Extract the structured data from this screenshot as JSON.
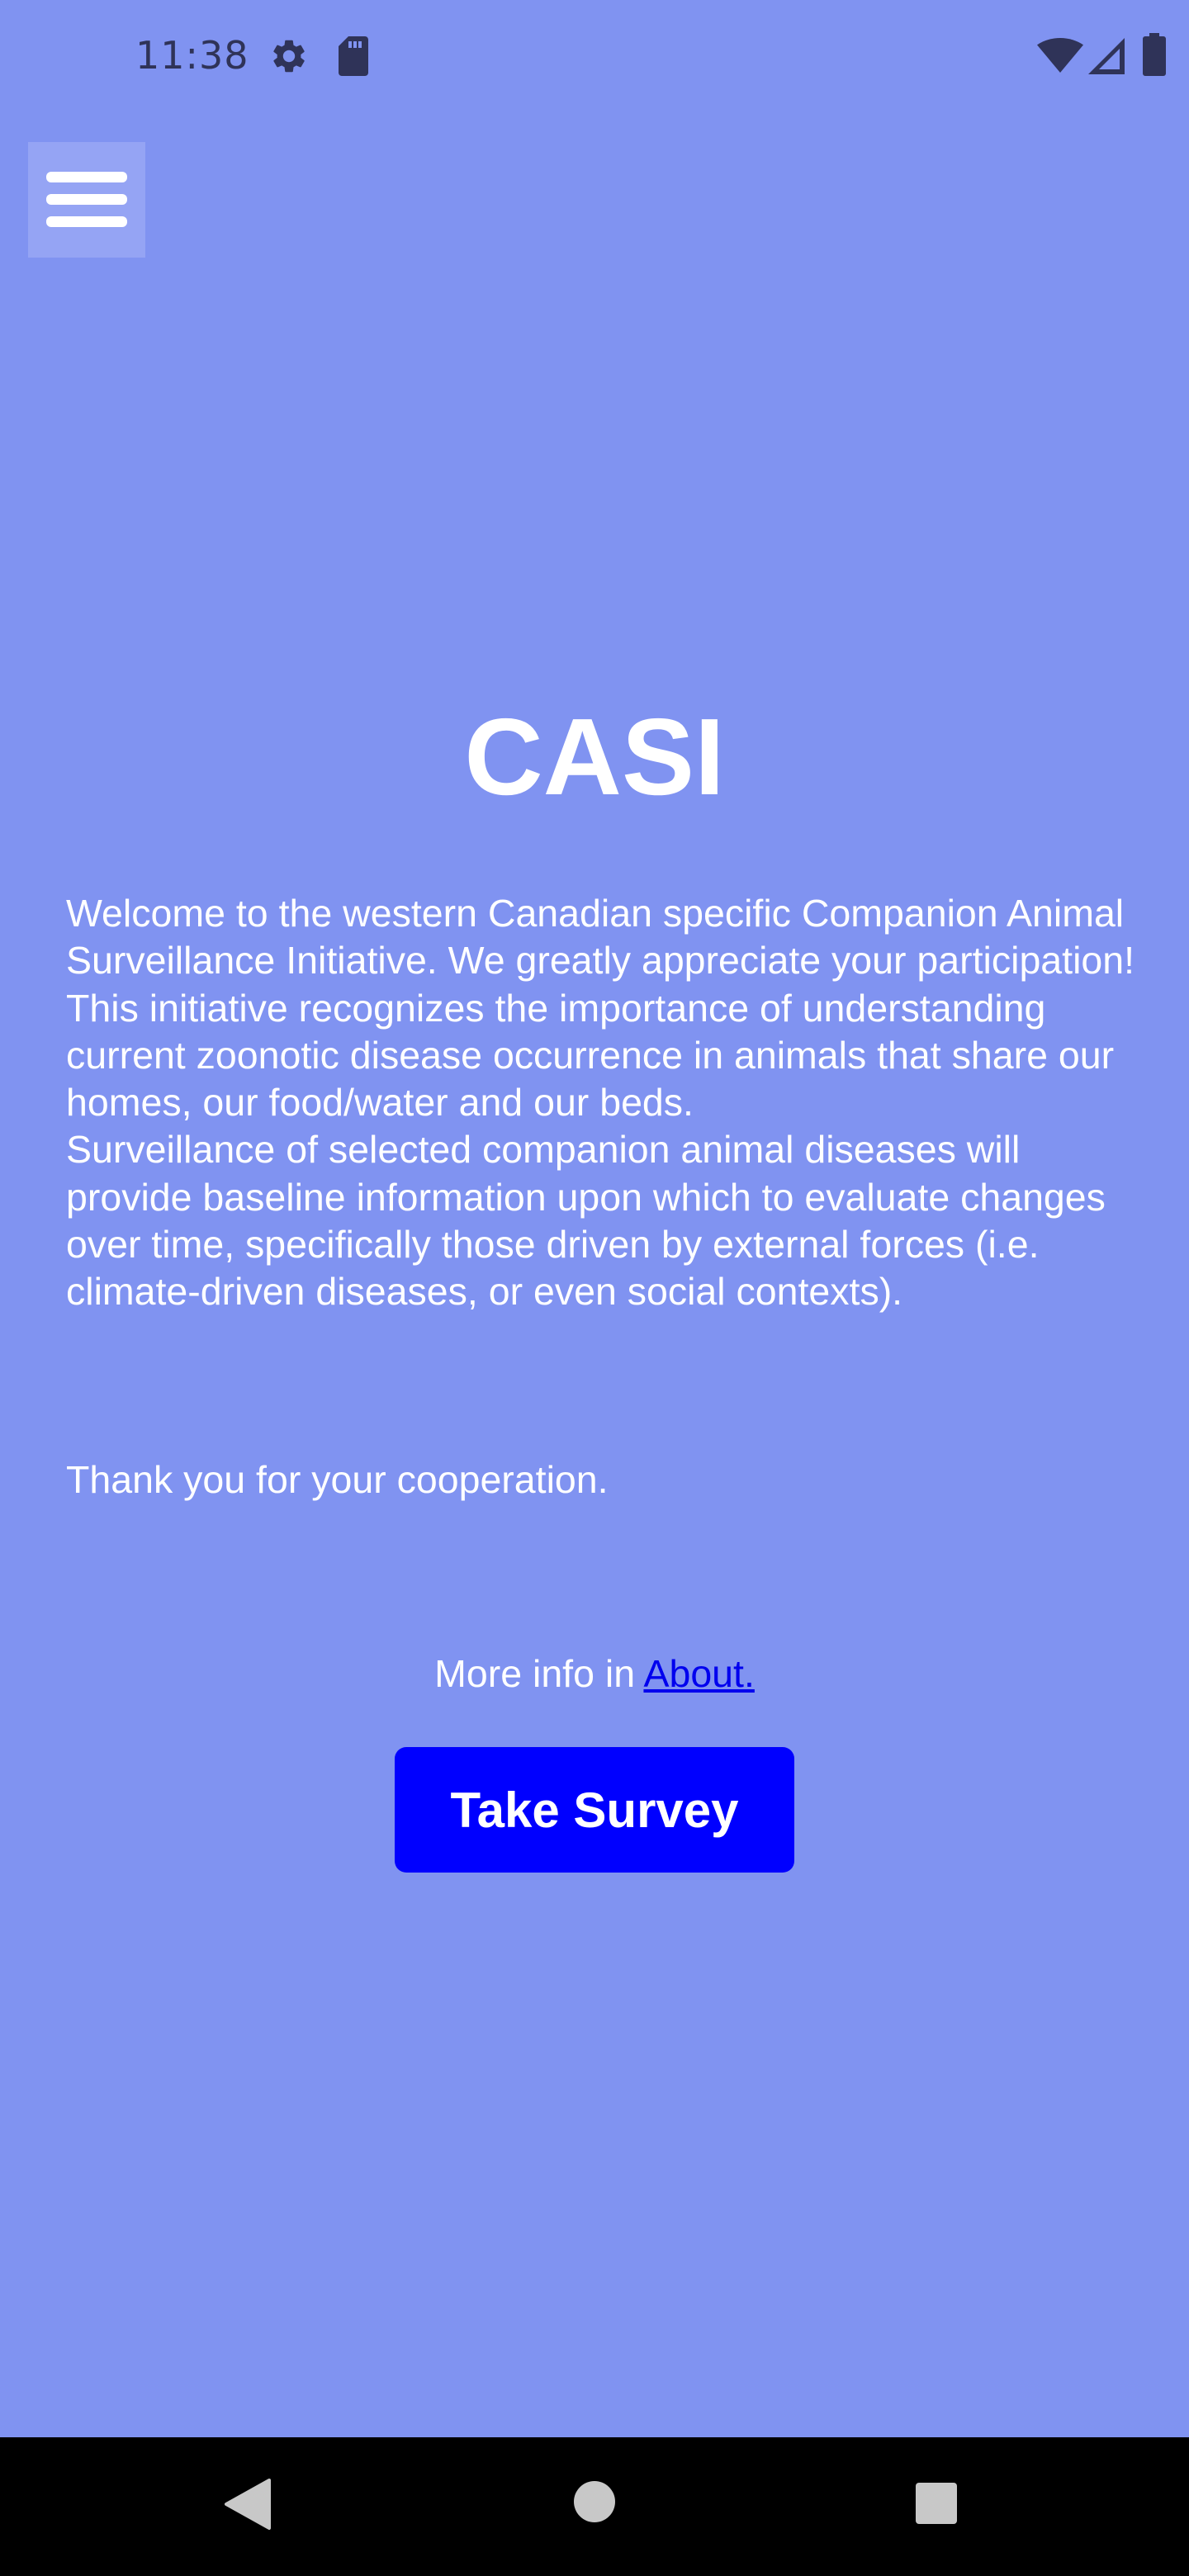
{
  "status_bar": {
    "time": "11:38",
    "icons": [
      "gear-icon",
      "sd-card-icon",
      "wifi-icon",
      "signal-icon",
      "battery-icon"
    ]
  },
  "menu": {
    "icon": "hamburger-menu-icon"
  },
  "content": {
    "title": "CASI",
    "paragraphs": [
      "Welcome to the western Canadian specific Companion Animal Surveillance Initiative. We greatly appreciate your participation!",
      "This initiative recognizes the importance of understanding current zoonotic disease occurrence in animals that share our homes, our food/water and our beds.",
      "Surveillance of selected companion animal diseases will provide baseline information upon which to evaluate changes over time, specifically those driven by external forces (i.e. climate-driven diseases, or even social contexts)."
    ],
    "thanks": "Thank you for your cooperation.",
    "more_info_prefix": "More info in ",
    "about_link": "About."
  },
  "actions": {
    "survey_label": "Take Survey"
  },
  "colors": {
    "background": "#8093f1",
    "button": "#0000ff",
    "link": "#0000ee",
    "text": "#ffffff"
  },
  "nav_bar": {
    "icons": [
      "back-icon",
      "home-icon",
      "recents-icon"
    ]
  }
}
